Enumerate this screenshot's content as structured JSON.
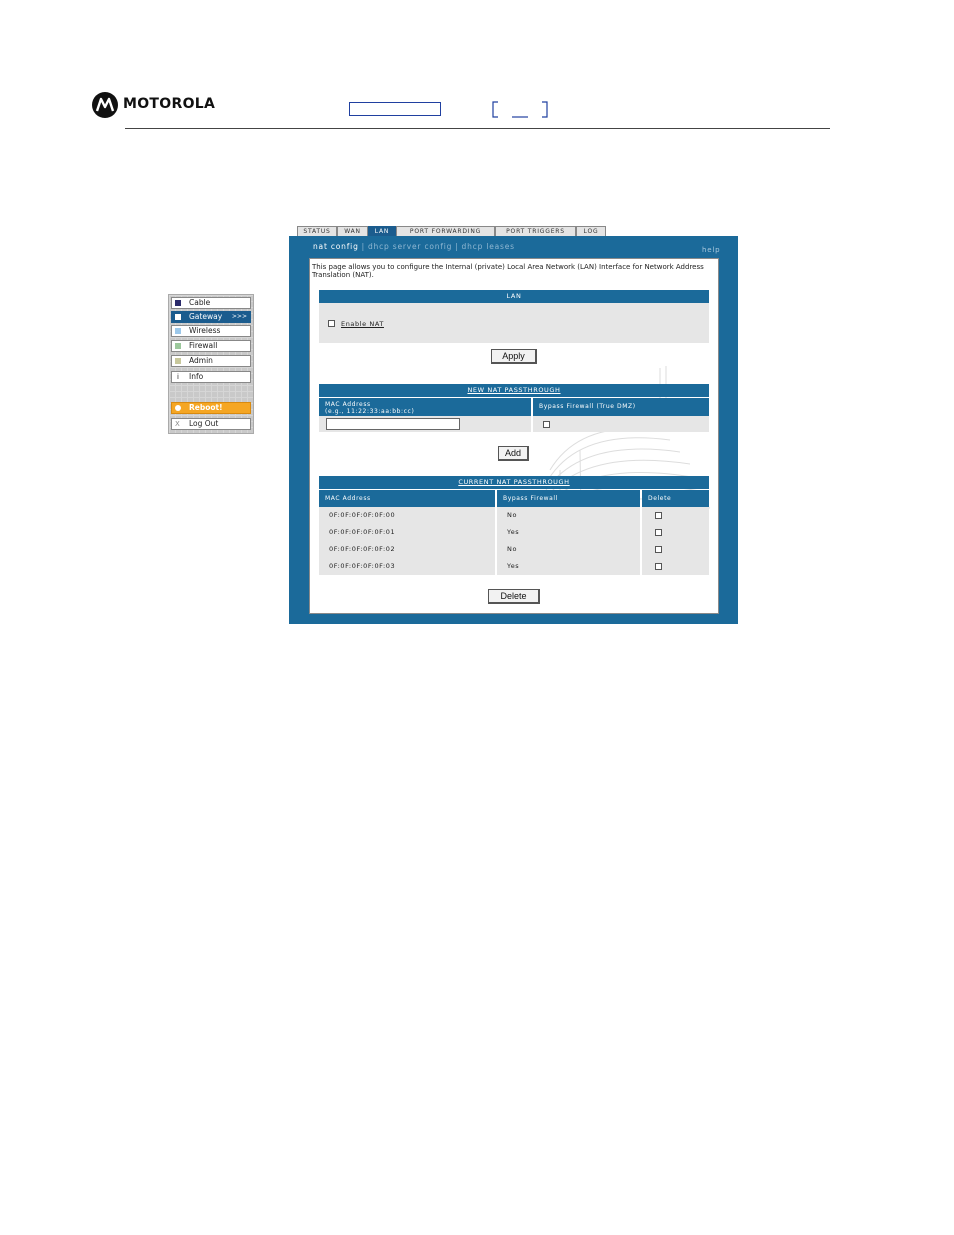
{
  "header": {
    "brand": "MOTOROLA",
    "icon": "motorola-logo"
  },
  "nav": {
    "items": [
      {
        "label": "Cable",
        "icon": "square-icon",
        "color": "#2b2b6b"
      },
      {
        "label": "Gateway",
        "icon": "square-icon",
        "color": "#ffffff",
        "active": true,
        "arrow": ">>>"
      },
      {
        "label": "Wireless",
        "icon": "square-icon",
        "color": "#9cc8ea"
      },
      {
        "label": "Firewall",
        "icon": "square-icon",
        "color": "#9cc89c"
      },
      {
        "label": "Admin",
        "icon": "square-icon",
        "color": "#c8c89c"
      },
      {
        "label": "Info",
        "icon": "info-icon",
        "color": "#ffffff",
        "glyph": "i"
      }
    ],
    "reboot": {
      "label": "Reboot!",
      "icon": "power-icon",
      "color": "#f5a623"
    },
    "logout": {
      "label": "Log Out",
      "icon": "close-icon",
      "glyph": "X"
    }
  },
  "tabs": [
    "STATUS",
    "WAN",
    "LAN",
    "PORT FORWARDING",
    "PORT TRIGGERS",
    "LOG"
  ],
  "active_tab": "LAN",
  "subnav": {
    "items": [
      "nat config",
      "dhcp server config",
      "dhcp leases"
    ],
    "active": "nat config",
    "help": "help"
  },
  "intro": "This page allows you to configure the Internal (private) Local Area Network (LAN) Interface for Network Address Translation (NAT).",
  "lan_section": {
    "title": "LAN",
    "enable_nat_label": "Enable NAT",
    "enable_nat_checked": false,
    "apply_label": "Apply"
  },
  "new_passthrough": {
    "title": "NEW NAT PASSTHROUGH",
    "mac_header_line1": "MAC Address",
    "mac_header_line2": "(e.g., 11:22:33:aa:bb:cc)",
    "mac_value": "",
    "bypass_header": "Bypass Firewall (True DMZ)",
    "bypass_checked": false,
    "add_label": "Add"
  },
  "current_passthrough": {
    "title": "CURRENT NAT PASSTHROUGH",
    "columns": [
      "MAC Address",
      "Bypass Firewall",
      "Delete"
    ],
    "rows": [
      {
        "mac": "0F:0F:0F:0F:0F:00",
        "bypass": "No",
        "delete": false
      },
      {
        "mac": "0F:0F:0F:0F:0F:01",
        "bypass": "Yes",
        "delete": false
      },
      {
        "mac": "0F:0F:0F:0F:0F:02",
        "bypass": "No",
        "delete": false
      },
      {
        "mac": "0F:0F:0F:0F:0F:03",
        "bypass": "Yes",
        "delete": false
      }
    ],
    "delete_label": "Delete"
  },
  "colors": {
    "panel_blue": "#1b6a9a",
    "nav_active": "#1b5c8e",
    "reboot_orange": "#f5a623"
  }
}
